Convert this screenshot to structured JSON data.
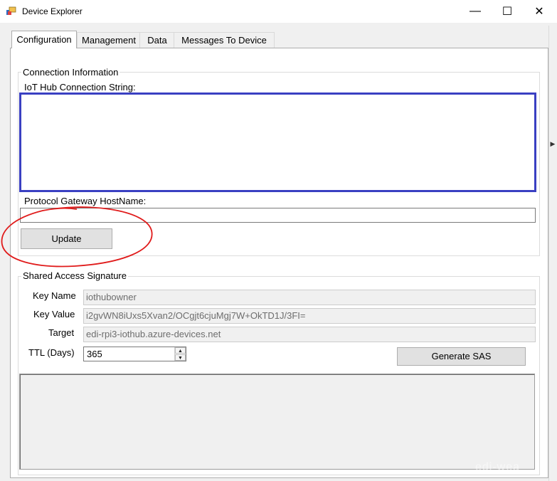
{
  "window": {
    "title": "Device Explorer",
    "controls": {
      "minimize": "—",
      "maximize": "☐",
      "close": "✕"
    }
  },
  "tabs": [
    {
      "label": "Configuration",
      "active": true
    },
    {
      "label": "Management",
      "active": false
    },
    {
      "label": "Data",
      "active": false
    },
    {
      "label": "Messages To Device",
      "active": false
    }
  ],
  "connection": {
    "group_title": "Connection Information",
    "conn_string_label": "IoT Hub Connection String:",
    "conn_string_value": "",
    "gateway_label": "Protocol Gateway HostName:",
    "gateway_value": "",
    "update_label": "Update"
  },
  "sas": {
    "group_title": "Shared Access Signature",
    "key_name_label": "Key Name",
    "key_name_value": "iothubowner",
    "key_value_label": "Key Value",
    "key_value_value": "i2gvWN8iUxs5Xvan2/OCgjt6cjuMgj7W+OkTD1J/3FI=",
    "target_label": "Target",
    "target_value": "edi-rpi3-iothub.azure-devices.net",
    "ttl_label": "TTL (Days)",
    "ttl_value": "365",
    "generate_label": "Generate SAS",
    "output": ""
  },
  "annotation_color": "#e01b1b",
  "highlight_color": "#3a40c2",
  "watermark": "edi-wea"
}
